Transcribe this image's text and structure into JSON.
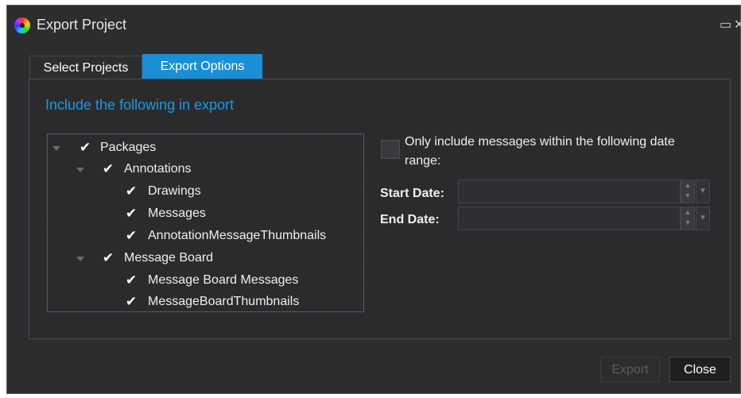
{
  "window": {
    "title": "Export Project",
    "maximize_glyph": "▭",
    "close_glyph": "✕"
  },
  "tabs": [
    {
      "label": "Select Projects",
      "active": false
    },
    {
      "label": "Export Options",
      "active": true
    }
  ],
  "panel": {
    "heading": "Include the following in export"
  },
  "tree": {
    "nodes": [
      {
        "label": "Packages",
        "level": 0,
        "checked": true,
        "expandable": true
      },
      {
        "label": "Annotations",
        "level": 1,
        "checked": true,
        "expandable": true
      },
      {
        "label": "Drawings",
        "level": 2,
        "checked": true,
        "expandable": false
      },
      {
        "label": "Messages",
        "level": 2,
        "checked": true,
        "expandable": false
      },
      {
        "label": "AnnotationMessageThumbnails",
        "level": 2,
        "checked": true,
        "expandable": false
      },
      {
        "label": "Message Board",
        "level": 1,
        "checked": true,
        "expandable": true
      },
      {
        "label": "Message Board Messages",
        "level": 2,
        "checked": true,
        "expandable": false
      },
      {
        "label": "MessageBoardThumbnails",
        "level": 2,
        "checked": true,
        "expandable": false
      }
    ],
    "check_glyph": "✔"
  },
  "date_range": {
    "checkbox_label": "Only include messages within the following date range:",
    "checked": false,
    "start_label": "Start Date:",
    "start_value": "",
    "end_label": "End Date:",
    "end_value": ""
  },
  "buttons": {
    "export_label": "Export",
    "close_label": "Close"
  },
  "colors": {
    "accent": "#1b8fd6",
    "heading": "#1b9ae0",
    "background": "#2d2d30"
  }
}
